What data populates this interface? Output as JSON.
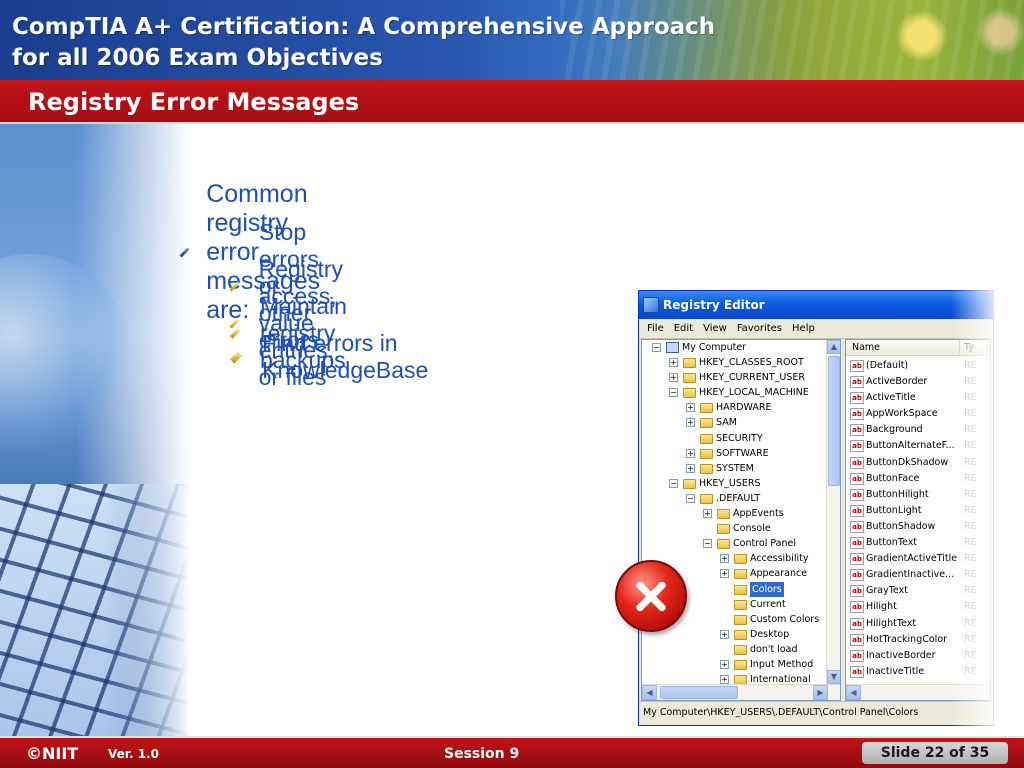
{
  "header": {
    "title_line1": "CompTIA A+ Certification: A Comprehensive Approach",
    "title_line2": "for all 2006 Exam Objectives"
  },
  "slide": {
    "title": "Registry Error Messages",
    "main_bullet": "Common registry error messages are:",
    "sub_bullets": [
      "Stop errors or other errors",
      "Registry access, value entries, or files",
      "Maintain registry backups",
      "Find errors in KnowledgeBase"
    ]
  },
  "regedit": {
    "title": "Registry Editor",
    "menu": [
      "File",
      "Edit",
      "View",
      "Favorites",
      "Help"
    ],
    "tree": [
      {
        "label": "My Computer",
        "expander": "−",
        "icon": "computer-icon"
      },
      {
        "label": "HKEY_CLASSES_ROOT",
        "expander": "+",
        "icon": "folder-icon"
      },
      {
        "label": "HKEY_CURRENT_USER",
        "expander": "+",
        "icon": "folder-icon"
      },
      {
        "label": "HKEY_LOCAL_MACHINE",
        "expander": "−",
        "icon": "folder-icon"
      },
      {
        "label": "HARDWARE",
        "expander": "+",
        "icon": "folder-icon"
      },
      {
        "label": "SAM",
        "expander": "+",
        "icon": "folder-icon"
      },
      {
        "label": "SECURITY",
        "expander": "",
        "icon": "folder-icon"
      },
      {
        "label": "SOFTWARE",
        "expander": "+",
        "icon": "folder-icon"
      },
      {
        "label": "SYSTEM",
        "expander": "+",
        "icon": "folder-icon"
      },
      {
        "label": "HKEY_USERS",
        "expander": "−",
        "icon": "folder-icon"
      },
      {
        "label": ".DEFAULT",
        "expander": "−",
        "icon": "folder-icon"
      },
      {
        "label": "AppEvents",
        "expander": "+",
        "icon": "folder-icon"
      },
      {
        "label": "Console",
        "expander": "",
        "icon": "folder-icon"
      },
      {
        "label": "Control Panel",
        "expander": "−",
        "icon": "folder-icon"
      },
      {
        "label": "Accessibility",
        "expander": "+",
        "icon": "folder-icon"
      },
      {
        "label": "Appearance",
        "expander": "+",
        "icon": "folder-icon"
      },
      {
        "label": "Colors",
        "expander": "",
        "icon": "folder-icon",
        "selected": true
      },
      {
        "label": "Current",
        "expander": "",
        "icon": "folder-icon"
      },
      {
        "label": "Custom Colors",
        "expander": "",
        "icon": "folder-icon"
      },
      {
        "label": "Desktop",
        "expander": "+",
        "icon": "folder-icon"
      },
      {
        "label": "don't load",
        "expander": "",
        "icon": "folder-icon"
      },
      {
        "label": "Input Method",
        "expander": "+",
        "icon": "folder-icon"
      },
      {
        "label": "International",
        "expander": "+",
        "icon": "folder-icon"
      }
    ],
    "columns": [
      "Name",
      "Ty"
    ],
    "values": [
      {
        "name": "(Default)",
        "type": "RE"
      },
      {
        "name": "ActiveBorder",
        "type": "RE"
      },
      {
        "name": "ActiveTitle",
        "type": "RE"
      },
      {
        "name": "AppWorkSpace",
        "type": "RE"
      },
      {
        "name": "Background",
        "type": "RE"
      },
      {
        "name": "ButtonAlternateF...",
        "type": "RE"
      },
      {
        "name": "ButtonDkShadow",
        "type": "RE"
      },
      {
        "name": "ButtonFace",
        "type": "RE"
      },
      {
        "name": "ButtonHilight",
        "type": "RE"
      },
      {
        "name": "ButtonLight",
        "type": "RE"
      },
      {
        "name": "ButtonShadow",
        "type": "RE"
      },
      {
        "name": "ButtonText",
        "type": "RE"
      },
      {
        "name": "GradientActiveTitle",
        "type": "RE"
      },
      {
        "name": "GradientInactive...",
        "type": "RE"
      },
      {
        "name": "GrayText",
        "type": "RE"
      },
      {
        "name": "Hilight",
        "type": "RE"
      },
      {
        "name": "HilightText",
        "type": "RE"
      },
      {
        "name": "HotTrackingColor",
        "type": "RE"
      },
      {
        "name": "InactiveBorder",
        "type": "RE"
      },
      {
        "name": "InactiveTitle",
        "type": "RE"
      }
    ],
    "value_icon_text": "ab",
    "status_path": "My Computer\\HKEY_USERS\\.DEFAULT\\Control Panel\\Colors"
  },
  "footer": {
    "logo": "©NIIT",
    "version": "Ver.  1.0",
    "session": "Session 9",
    "slide_number": "Slide 22 of 35"
  },
  "colors": {
    "header_blue": "#1b3d8f",
    "title_red": "#b3101a",
    "bullet_text": "#1e4fb3",
    "footer_red": "#a80c10"
  }
}
